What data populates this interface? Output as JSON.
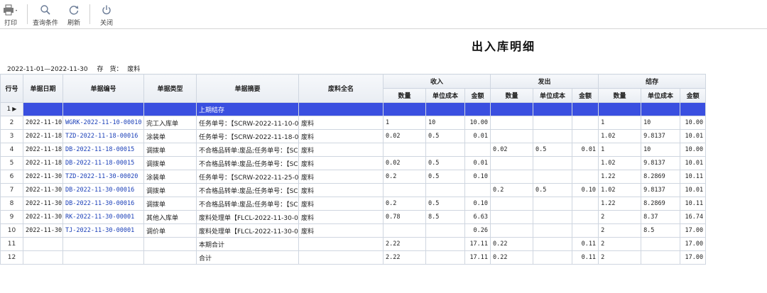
{
  "toolbar": {
    "print": "打印",
    "query": "查询条件",
    "refresh": "刷新",
    "close": "关闭"
  },
  "report": {
    "title": "出入库明细",
    "date_range": "2022-11-01—2022-11-30",
    "stock_label": "存　货：",
    "stock_value": "废料"
  },
  "columns": {
    "row_no": "行号",
    "doc_date": "单据日期",
    "doc_no": "单据编号",
    "doc_type": "单据类型",
    "summary": "单据摘要",
    "material": "废料全名",
    "in_group": "收入",
    "out_group": "发出",
    "bal_group": "结存",
    "qty": "数量",
    "unit_cost": "单位成本",
    "amount": "金额"
  },
  "rows": [
    {
      "no": "1",
      "date": "",
      "code": "",
      "type": "",
      "summary": "上期结存",
      "material": "",
      "in_qty": "",
      "in_cost": "",
      "in_amt": "",
      "out_qty": "",
      "out_cost": "",
      "out_amt": "",
      "bal_qty": "",
      "bal_cost": "",
      "bal_amt": ""
    },
    {
      "no": "2",
      "date": "2022-11-10",
      "code": "WGRK-2022-11-10-00010",
      "type": "完工入库单",
      "summary": "任务单号：【SCRW-2022-11-10-0001",
      "material": "废料",
      "in_qty": "1",
      "in_cost": "10",
      "in_amt": "10.00",
      "out_qty": "",
      "out_cost": "",
      "out_amt": "",
      "bal_qty": "1",
      "bal_cost": "10",
      "bal_amt": "10.00"
    },
    {
      "no": "3",
      "date": "2022-11-18",
      "code": "TZD-2022-11-18-00016",
      "type": "涂装单",
      "summary": "任务单号：【SCRW-2022-11-18-0001",
      "material": "废料",
      "in_qty": "0.02",
      "in_cost": "0.5",
      "in_amt": "0.01",
      "out_qty": "",
      "out_cost": "",
      "out_amt": "",
      "bal_qty": "1.02",
      "bal_cost": "9.8137",
      "bal_amt": "10.01"
    },
    {
      "no": "4",
      "date": "2022-11-18",
      "code": "DB-2022-11-18-00015",
      "type": "调拨单",
      "summary": "不合格品转单:废品;任务单号：【SC",
      "material": "废料",
      "in_qty": "",
      "in_cost": "",
      "in_amt": "",
      "out_qty": "0.02",
      "out_cost": "0.5",
      "out_amt": "0.01",
      "bal_qty": "1",
      "bal_cost": "10",
      "bal_amt": "10.00"
    },
    {
      "no": "5",
      "date": "2022-11-18",
      "code": "DB-2022-11-18-00015",
      "type": "调拨单",
      "summary": "不合格品转单:废品;任务单号：【SC",
      "material": "废料",
      "in_qty": "0.02",
      "in_cost": "0.5",
      "in_amt": "0.01",
      "out_qty": "",
      "out_cost": "",
      "out_amt": "",
      "bal_qty": "1.02",
      "bal_cost": "9.8137",
      "bal_amt": "10.01"
    },
    {
      "no": "6",
      "date": "2022-11-30",
      "code": "TZD-2022-11-30-00020",
      "type": "涂装单",
      "summary": "任务单号：【SCRW-2022-11-25-0002",
      "material": "废料",
      "in_qty": "0.2",
      "in_cost": "0.5",
      "in_amt": "0.10",
      "out_qty": "",
      "out_cost": "",
      "out_amt": "",
      "bal_qty": "1.22",
      "bal_cost": "8.2869",
      "bal_amt": "10.11"
    },
    {
      "no": "7",
      "date": "2022-11-30",
      "code": "DB-2022-11-30-00016",
      "type": "调拨单",
      "summary": "不合格品转单:废品;任务单号：【SC",
      "material": "废料",
      "in_qty": "",
      "in_cost": "",
      "in_amt": "",
      "out_qty": "0.2",
      "out_cost": "0.5",
      "out_amt": "0.10",
      "bal_qty": "1.02",
      "bal_cost": "9.8137",
      "bal_amt": "10.01"
    },
    {
      "no": "8",
      "date": "2022-11-30",
      "code": "DB-2022-11-30-00016",
      "type": "调拨单",
      "summary": "不合格品转单:废品;任务单号：【SC",
      "material": "废料",
      "in_qty": "0.2",
      "in_cost": "0.5",
      "in_amt": "0.10",
      "out_qty": "",
      "out_cost": "",
      "out_amt": "",
      "bal_qty": "1.22",
      "bal_cost": "8.2869",
      "bal_amt": "10.11"
    },
    {
      "no": "9",
      "date": "2022-11-30",
      "code": "RK-2022-11-30-00001",
      "type": "其他入库单",
      "summary": "废料处理单【FLCL-2022-11-30-0000",
      "material": "废料",
      "in_qty": "0.78",
      "in_cost": "8.5",
      "in_amt": "6.63",
      "out_qty": "",
      "out_cost": "",
      "out_amt": "",
      "bal_qty": "2",
      "bal_cost": "8.37",
      "bal_amt": "16.74"
    },
    {
      "no": "10",
      "date": "2022-11-30",
      "code": "TJ-2022-11-30-00001",
      "type": "调价单",
      "summary": "废料处理单【FLCL-2022-11-30-0000",
      "material": "废料",
      "in_qty": "",
      "in_cost": "",
      "in_amt": "0.26",
      "out_qty": "",
      "out_cost": "",
      "out_amt": "",
      "bal_qty": "2",
      "bal_cost": "8.5",
      "bal_amt": "17.00"
    },
    {
      "no": "11",
      "date": "",
      "code": "",
      "type": "",
      "summary": "本期合计",
      "material": "",
      "in_qty": "2.22",
      "in_cost": "",
      "in_amt": "17.11",
      "out_qty": "0.22",
      "out_cost": "",
      "out_amt": "0.11",
      "bal_qty": "2",
      "bal_cost": "",
      "bal_amt": "17.00"
    },
    {
      "no": "12",
      "date": "",
      "code": "",
      "type": "",
      "summary": "合计",
      "material": "",
      "in_qty": "2.22",
      "in_cost": "",
      "in_amt": "17.11",
      "out_qty": "0.22",
      "out_cost": "",
      "out_amt": "0.11",
      "bal_qty": "2",
      "bal_cost": "",
      "bal_amt": "17.00"
    }
  ],
  "colors": {
    "selection": "#3a4fe0",
    "link": "#1a3fb8",
    "grid_border": "#cfd6e0"
  }
}
